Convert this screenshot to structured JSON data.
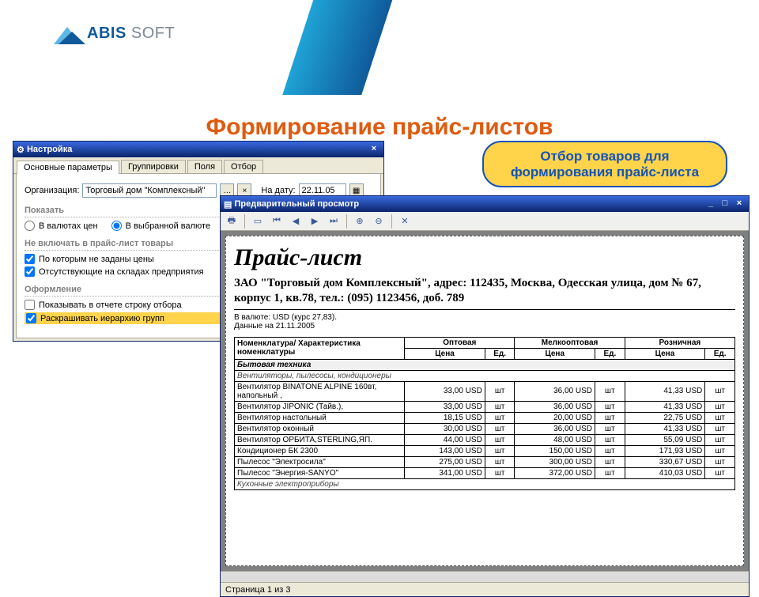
{
  "branding": {
    "logo_primary": "ABIS",
    "logo_secondary": "SOFT"
  },
  "slide": {
    "title": "Формирование прайс-листов",
    "callout": "Отбор товаров для формирования прайс-листа"
  },
  "settings_window": {
    "title": "Настройка",
    "close": "×",
    "tabs": [
      "Основные параметры",
      "Группировки",
      "Поля",
      "Отбор"
    ],
    "active_tab": 0,
    "org_label": "Организация:",
    "org_value": "Торговый дом \"Комплексный\"",
    "date_label": "На дату:",
    "date_value": "22.11.05",
    "section_show": "Показать",
    "radio1": "В валютах цен",
    "radio2": "В выбранной валюте",
    "section_exclude": "Не включать в прайс-лист товары",
    "chk1": "По которым не заданы цены",
    "chk2": "Отсутствующие на складах предприятия",
    "section_format": "Оформление",
    "chk3": "Показывать в отчете строку отбора",
    "chk4": "Раскрашивать иерархию групп"
  },
  "preview_window": {
    "title": "Предварительный просмотр",
    "minimize": "_",
    "maximize": "□",
    "close": "×",
    "status": "Страница 1 из 3",
    "document": {
      "heading": "Прайс-лист",
      "company": "ЗАО \"Торговый дом Комплексный\", адрес: 112435, Москва, Одесская улица, дом № 67, корпус 1, кв.78, тел.: (095) 1123456, доб. 789",
      "currency_line": "В валюте: USD (курс 27,83).",
      "date_line": "Данные на 21.11.2005",
      "col_name": "Номенклатура/ Характеристика номенклатуры",
      "price_cols": [
        "Оптовая",
        "Мелкооптовая",
        "Розничная"
      ],
      "sub_price": "Цена",
      "sub_unit": "Ед.",
      "group1": "Бытовая техника",
      "subgroup1": "Вентиляторы, пылесосы, кондиционеры",
      "rows": [
        {
          "name": "Вентилятор BINATONE ALPINE 160вт, напольный ,",
          "p": [
            "33,00 USD",
            "шт",
            "36,00 USD",
            "шт",
            "41,33 USD",
            "шт"
          ]
        },
        {
          "name": "Вентилятор JIPONIC (Тайв.),",
          "p": [
            "33,00 USD",
            "шт",
            "36,00 USD",
            "шт",
            "41,33 USD",
            "шт"
          ]
        },
        {
          "name": "Вентилятор настольный",
          "p": [
            "18,15 USD",
            "шт",
            "20,00 USD",
            "шт",
            "22,75 USD",
            "шт"
          ]
        },
        {
          "name": "Вентилятор оконный",
          "p": [
            "30,00 USD",
            "шт",
            "36,00 USD",
            "шт",
            "41,33 USD",
            "шт"
          ]
        },
        {
          "name": "Вентилятор ОРБИТА,STERLING,ЯП.",
          "p": [
            "44,00 USD",
            "шт",
            "48,00 USD",
            "шт",
            "55,09 USD",
            "шт"
          ]
        },
        {
          "name": "Кондиционер БК 2300",
          "p": [
            "143,00 USD",
            "шт",
            "150,00 USD",
            "шт",
            "171,93 USD",
            "шт"
          ]
        },
        {
          "name": "Пылесос \"Электросила\"",
          "p": [
            "275,00 USD",
            "шт",
            "300,00 USD",
            "шт",
            "330,67 USD",
            "шт"
          ]
        },
        {
          "name": "Пылесос \"Энергия-SANYO\"",
          "p": [
            "341,00 USD",
            "шт",
            "372,00 USD",
            "шт",
            "410,03 USD",
            "шт"
          ]
        }
      ],
      "subgroup2": "Кухонные электроприборы"
    }
  },
  "chart_data": {
    "type": "table",
    "title": "Прайс-лист",
    "columns": [
      "Номенклатура",
      "Оптовая Цена (USD)",
      "Мелкооптовая Цена (USD)",
      "Розничная Цена (USD)",
      "Ед."
    ],
    "rows": [
      [
        "Вентилятор BINATONE ALPINE 160вт, напольный",
        33.0,
        36.0,
        41.33,
        "шт"
      ],
      [
        "Вентилятор JIPONIC (Тайв.)",
        33.0,
        36.0,
        41.33,
        "шт"
      ],
      [
        "Вентилятор настольный",
        18.15,
        20.0,
        22.75,
        "шт"
      ],
      [
        "Вентилятор оконный",
        30.0,
        36.0,
        41.33,
        "шт"
      ],
      [
        "Вентилятор ОРБИТА,STERLING,ЯП.",
        44.0,
        48.0,
        55.09,
        "шт"
      ],
      [
        "Кондиционер БК 2300",
        143.0,
        150.0,
        171.93,
        "шт"
      ],
      [
        "Пылесос \"Электросила\"",
        275.0,
        300.0,
        330.67,
        "шт"
      ],
      [
        "Пылесос \"Энергия-SANYO\"",
        341.0,
        372.0,
        410.03,
        "шт"
      ]
    ]
  }
}
